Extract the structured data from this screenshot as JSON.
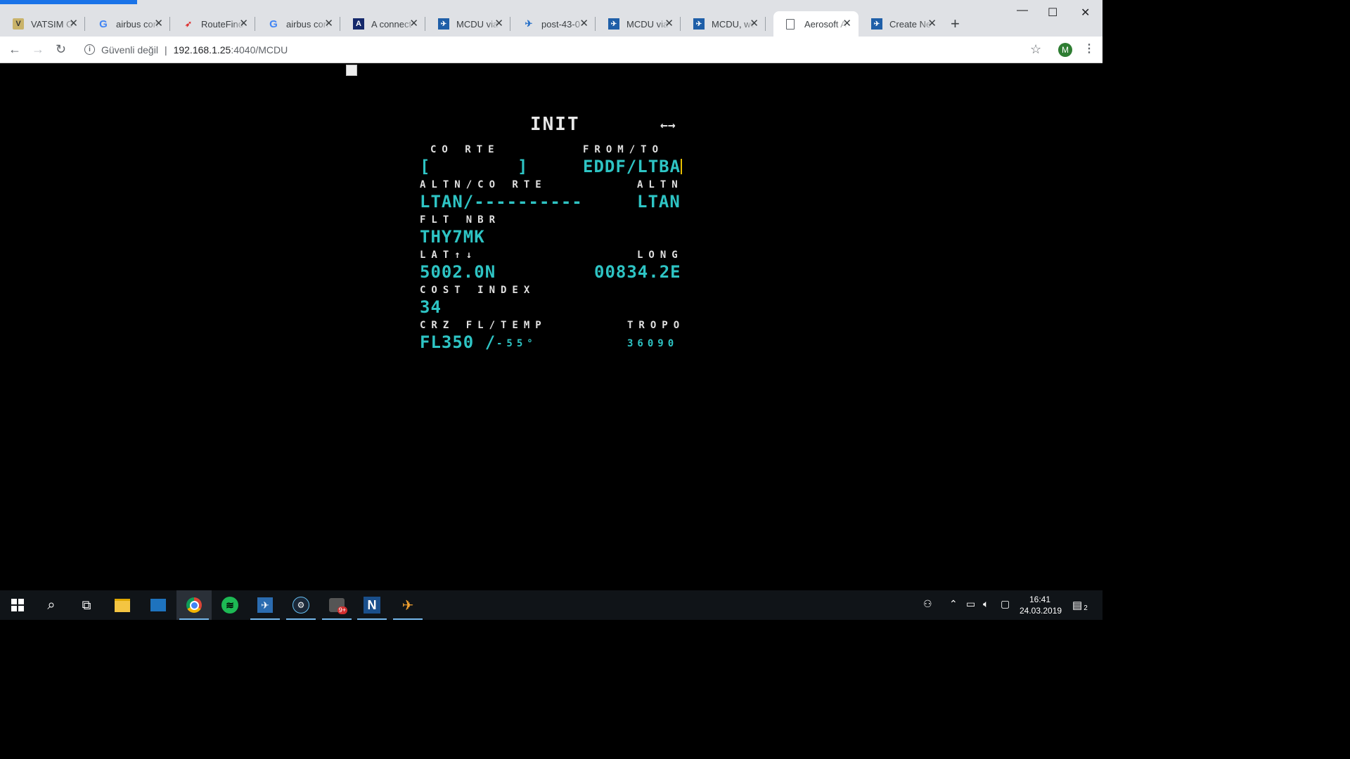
{
  "browser": {
    "tabs": [
      {
        "title": "VATSIM Online",
        "icon": "vatsim-icon",
        "active": false
      },
      {
        "title": "airbus control",
        "icon": "google-icon",
        "active": false
      },
      {
        "title": "RouteFinder",
        "icon": "routefinder-icon",
        "active": false
      },
      {
        "title": "airbus control",
        "icon": "google-icon",
        "active": false
      },
      {
        "title": "A connect",
        "icon": "a-icon",
        "active": false
      },
      {
        "title": "MCDU via",
        "icon": "mcdu-site-icon",
        "active": false
      },
      {
        "title": "post-43-0",
        "icon": "post-icon",
        "active": false
      },
      {
        "title": "MCDU via",
        "icon": "mcdu-site-icon",
        "active": false
      },
      {
        "title": "MCDU, we",
        "icon": "mcdu-site-icon",
        "active": false
      },
      {
        "title": "Aerosoft A",
        "icon": "document-icon",
        "active": true
      },
      {
        "title": "Create Ne",
        "icon": "mcdu-site-icon",
        "active": false
      }
    ],
    "close_glyph": "✕",
    "newtab_glyph": "+",
    "window": {
      "minimize": "—",
      "maximize": "☐",
      "close": "✕"
    },
    "address": {
      "security_label": "Güvenli değil",
      "separator": "|",
      "host": "192.168.1.25",
      "path": ":4040/MCDU"
    },
    "profile_initial": "M"
  },
  "mcdu": {
    "title": "INIT",
    "arrows": "←→",
    "l1_label": "CO RTE",
    "l1_value": "[        ]",
    "r1_label": "FROM/TO",
    "r1_value": "EDDF/LTBA",
    "l2_label": "ALTN/CO RTE",
    "l2_value": "LTAN/----------",
    "r2_label": "ALTN",
    "r2_value": "LTAN",
    "l3_label": "FLT NBR",
    "l3_value": "THY7MK",
    "l4_label": "LAT↑↓",
    "l4_value": "5002.0N",
    "r4_label": "LONG",
    "r4_value": "00834.2E",
    "l5_label": "COST INDEX",
    "l5_value": "34",
    "l6_label": "CRZ FL/TEMP",
    "l6_value_fl": "FL350 /",
    "l6_value_temp": "-55°",
    "r6_label": "TROPO",
    "r6_value": "36090"
  },
  "taskbar": {
    "apps": [
      "start-button",
      "search",
      "task-view",
      "file-explorer",
      "outlook",
      "chrome",
      "spotify",
      "flight-sim",
      "steam",
      "notifications-app",
      "notepad",
      "airplane-app"
    ],
    "clock_time": "16:41",
    "clock_date": "24.03.2019",
    "notification_count": "2"
  },
  "colors": {
    "mcdu_cyan": "#2ec4c4",
    "mcdu_label": "#e0e0e0",
    "tab_strip": "#dfe1e5",
    "taskbar": "#101418"
  }
}
